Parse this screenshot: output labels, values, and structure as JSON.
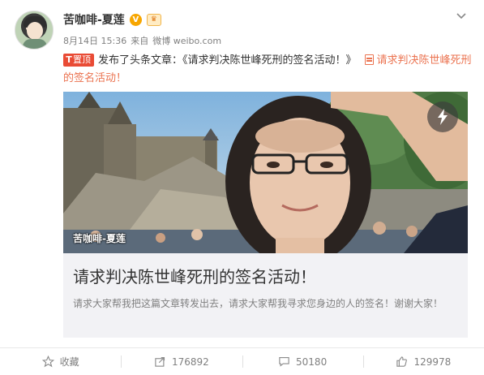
{
  "post": {
    "username": "苦咖啡-夏莲",
    "verified_badge": "V",
    "crown_badge": "♛",
    "timestamp": "8月14日 15:36",
    "source_prefix": "来自",
    "source": "微博 weibo.com",
    "top_tag": "置顶",
    "pin_glyph": "T",
    "headline_text": "发布了头条文章：《请求判决陈世峰死刑的签名活动！》",
    "article_link": "请求判决陈世峰死刑的签名活动！"
  },
  "card": {
    "image_watermark": "苦咖啡-夏莲",
    "title": "请求判决陈世峰死刑的签名活动！",
    "description": "请求大家帮我把这篇文章转发出去，请求大家帮我寻求您身边的人的签名！谢谢大家！"
  },
  "actions": {
    "favorite_label": "收藏",
    "repost_count": "176892",
    "comment_count": "50180",
    "like_count": "129978"
  },
  "icons": {
    "menu": "chevron-down-icon",
    "favorite": "star-icon",
    "repost": "share-icon",
    "comment": "comment-icon",
    "like": "thumbs-up-icon",
    "card": "lightning-icon",
    "article": "document-icon"
  },
  "colors": {
    "accent": "#eb7350",
    "top_tag": "#e94b35",
    "verified": "#f7a600",
    "card_bg": "#f2f2f5"
  }
}
